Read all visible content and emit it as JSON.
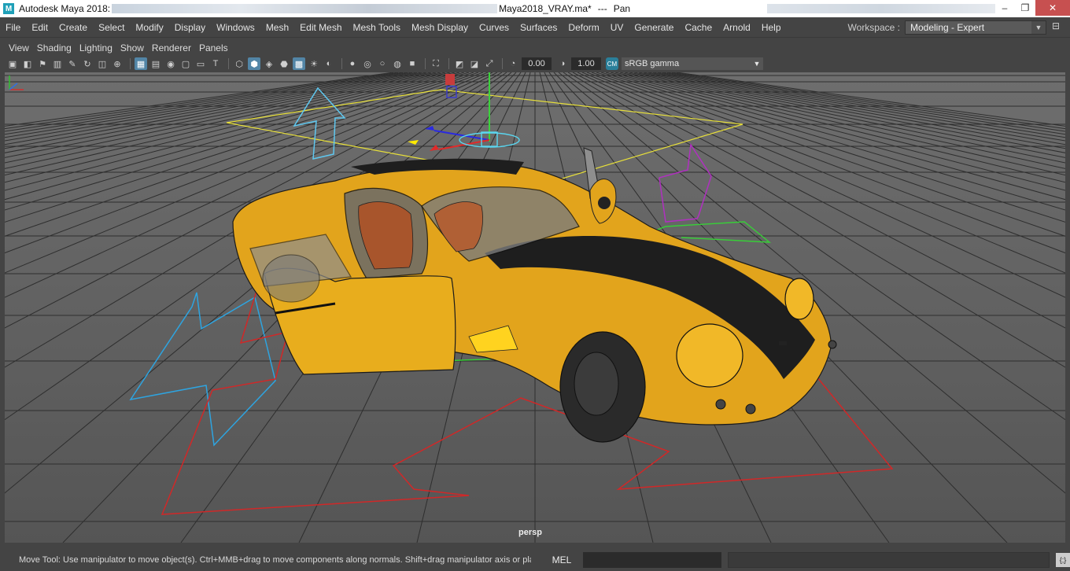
{
  "app": {
    "title_prefix": "Autodesk Maya 2018:",
    "title_file": "Maya2018_VRAY.ma*",
    "title_sep": "---",
    "title_tool": "Pan",
    "logo_letter": "M"
  },
  "window_buttons": {
    "minimize": "‒",
    "maximize": "❐",
    "close": "✕"
  },
  "menus": [
    "File",
    "Edit",
    "Create",
    "Select",
    "Modify",
    "Display",
    "Windows",
    "Mesh",
    "Edit Mesh",
    "Mesh Tools",
    "Mesh Display",
    "Curves",
    "Surfaces",
    "Deform",
    "UV",
    "Generate",
    "Cache",
    "Arnold",
    "Help"
  ],
  "workspace": {
    "label": "Workspace :",
    "value": "Modeling - Expert"
  },
  "panel_menus": [
    "View",
    "Shading",
    "Lighting",
    "Show",
    "Renderer",
    "Panels"
  ],
  "toolbar": {
    "exposure": "0.00",
    "gamma": "1.00",
    "color_space": "sRGB gamma",
    "color_icon_text": "CM"
  },
  "viewport": {
    "camera": "persp",
    "accent": "#ffd11a"
  },
  "status": {
    "message": "Move Tool: Use manipulator to move object(s). Ctrl+MMB+drag to move components along normals. Shift+drag manipulator axis or plane handles t",
    "mel_label": "MEL",
    "script_icon": "{;}"
  },
  "icons": [
    "select-icon",
    "lasso-icon",
    "paint-icon",
    "camera-icon",
    "grid-icon",
    "wireframe-icon",
    "shaded-icon",
    "texture-icon",
    "light-icon",
    "shadow-icon",
    "isolate-icon",
    "xray-icon",
    "exposure-icon",
    "gamma-icon"
  ]
}
